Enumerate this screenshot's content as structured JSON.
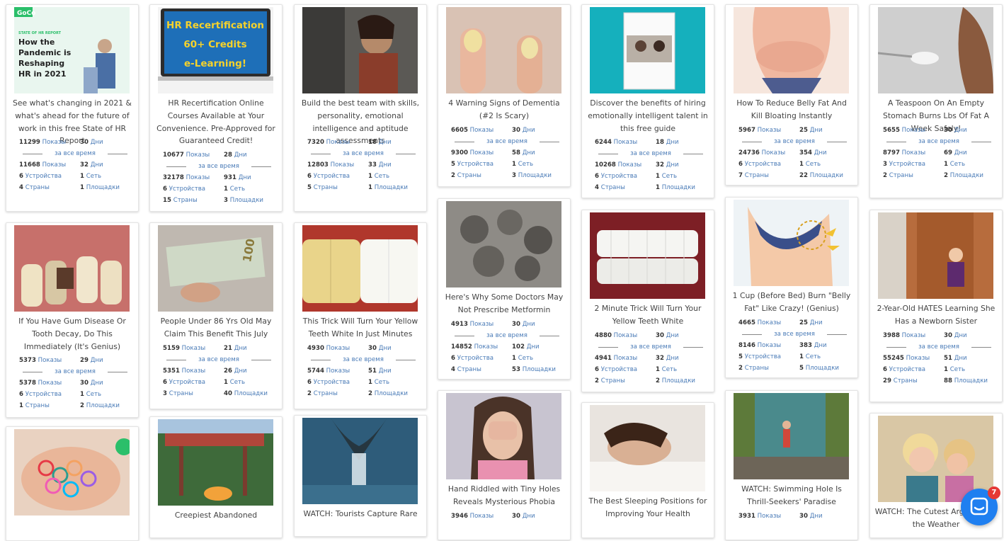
{
  "labels": {
    "impressions": "Показы",
    "days": "Дни",
    "all_time": "за все время",
    "devices": "Устройства",
    "networks": "Сеть",
    "countries": "Страны",
    "platforms": "Площадки"
  },
  "ads": [
    {
      "title": "See what's changing in 2021 & what's ahead for the future of work in this free State of HR Report",
      "icon": "hr-report-image",
      "stats": {
        "imp1": "11299",
        "days1": "30",
        "imp2": "11668",
        "days2": "32",
        "devices": "6",
        "networks": "1",
        "countries": "4",
        "platforms": "1"
      },
      "thumb_text": {
        "brand": "GoCo",
        "kicker": "STATE OF HR REPORT",
        "line1": "How the",
        "line2": "Pandemic is",
        "line3": "Reshaping",
        "line4": "HR in 2021"
      }
    },
    {
      "title": "HR Recertification Online Courses Available at Your Convenience. Pre-Approved for Guaranteed Credit!",
      "icon": "laptop-image",
      "stats": {
        "imp1": "10677",
        "days1": "28",
        "imp2": "32178",
        "days2": "931",
        "devices": "6",
        "networks": "1",
        "countries": "15",
        "platforms": "3"
      },
      "thumb_text": {
        "line1": "HR Recertification",
        "line2": "60+ Credits",
        "line3": "e-Learning!"
      }
    },
    {
      "title": "Build the best team with skills, personality, emotional intelligence and aptitude assessments",
      "icon": "woman-glasses-image",
      "stats": {
        "imp1": "7320",
        "days1": "18",
        "imp2": "12803",
        "days2": "33",
        "devices": "6",
        "networks": "1",
        "countries": "5",
        "platforms": "1"
      }
    },
    {
      "title": "4 Warning Signs of Dementia (#2 Is Scary)",
      "icon": "fingernails-image",
      "stats": {
        "imp1": "6605",
        "days1": "30",
        "imp2": "9300",
        "days2": "58",
        "devices": "5",
        "networks": "1",
        "countries": "2",
        "platforms": "3"
      }
    },
    {
      "title": "Discover the benefits of hiring emotionally intelligent talent in this free guide",
      "icon": "guide-book-image",
      "stats": {
        "imp1": "6244",
        "days1": "18",
        "imp2": "10268",
        "days2": "32",
        "devices": "6",
        "networks": "1",
        "countries": "4",
        "platforms": "1"
      }
    },
    {
      "title": "How To Reduce Belly Fat And Kill Bloating Instantly",
      "icon": "belly-fat-image",
      "stats": {
        "imp1": "5967",
        "days1": "25",
        "imp2": "24736",
        "days2": "354",
        "devices": "6",
        "networks": "1",
        "countries": "7",
        "platforms": "22"
      }
    },
    {
      "title": "A Teaspoon On An Empty Stomach Burns Lbs Of Fat A Week Safely!",
      "icon": "teaspoon-image",
      "stats": {
        "imp1": "5655",
        "days1": "30",
        "imp2": "8797",
        "days2": "69",
        "devices": "3",
        "networks": "1",
        "countries": "2",
        "platforms": "2"
      }
    },
    {
      "title": "If You Have Gum Disease Or Tooth Decay, Do This Immediately (It's Genius)",
      "icon": "teeth-decay-image",
      "stats": {
        "imp1": "5373",
        "days1": "29",
        "imp2": "5378",
        "days2": "30",
        "devices": "6",
        "networks": "1",
        "countries": "1",
        "platforms": "2"
      }
    },
    {
      "title": "People Under 86 Yrs Old May Claim This Benefit This July",
      "icon": "dollar-bill-image",
      "stats": {
        "imp1": "5159",
        "days1": "21",
        "imp2": "5351",
        "days2": "26",
        "devices": "6",
        "networks": "1",
        "countries": "3",
        "platforms": "40"
      }
    },
    {
      "title": "This Trick Will Turn Your Yellow Teeth White In Just Minutes",
      "icon": "yellow-white-teeth-image",
      "stats": {
        "imp1": "4930",
        "days1": "30",
        "imp2": "5744",
        "days2": "51",
        "devices": "6",
        "networks": "1",
        "countries": "2",
        "platforms": "2"
      }
    },
    {
      "title": "Here's Why Some Doctors May Not Prescribe Metformin",
      "icon": "grey-nuts-image",
      "stats": {
        "imp1": "4913",
        "days1": "30",
        "imp2": "14852",
        "days2": "102",
        "devices": "6",
        "networks": "1",
        "countries": "4",
        "platforms": "53"
      }
    },
    {
      "title": "2 Minute Trick Will Turn Your Yellow Teeth White",
      "icon": "white-teeth-image",
      "stats": {
        "imp1": "4880",
        "days1": "30",
        "imp2": "4941",
        "days2": "32",
        "devices": "6",
        "networks": "1",
        "countries": "2",
        "platforms": "2"
      }
    },
    {
      "title": "1 Cup (Before Bed) Burn \"Belly Fat\" Like Crazy! (Genius)",
      "icon": "hip-arrows-image",
      "stats": {
        "imp1": "4665",
        "days1": "25",
        "imp2": "8146",
        "days2": "383",
        "devices": "5",
        "networks": "1",
        "countries": "2",
        "platforms": "5"
      }
    },
    {
      "title": "2-Year-Old HATES Learning She Has a Newborn Sister",
      "icon": "toddler-door-image",
      "stats": {
        "imp1": "3988",
        "days1": "30",
        "imp2": "55245",
        "days2": "51",
        "devices": "6",
        "networks": "1",
        "countries": "29",
        "platforms": "88"
      }
    },
    {
      "title": "",
      "icon": "rubber-bands-image",
      "stats": null
    },
    {
      "title": "Creepiest Abandoned",
      "icon": "abandoned-park-image",
      "stats": null
    },
    {
      "title": "WATCH: Tourists Capture Rare",
      "icon": "whale-tail-image",
      "stats": null
    },
    {
      "title": "Hand Riddled with Tiny Holes Reveals Mysterious Phobia",
      "icon": "scared-woman-image",
      "stats": {
        "imp1": "3946",
        "days1": "30"
      }
    },
    {
      "title": "The Best Sleeping Positions for Improving Your Health",
      "icon": "sleeping-woman-image",
      "stats": null
    },
    {
      "title": "WATCH: Swimming Hole Is Thrill-Seekers' Paradise",
      "icon": "swimming-hole-image",
      "stats": {
        "imp1": "3931",
        "days1": "30"
      }
    },
    {
      "title": "WATCH: The Cutest Argu... Over the Weather",
      "icon": "toddlers-image",
      "stats": null
    }
  ],
  "chat": {
    "badge": "7"
  }
}
